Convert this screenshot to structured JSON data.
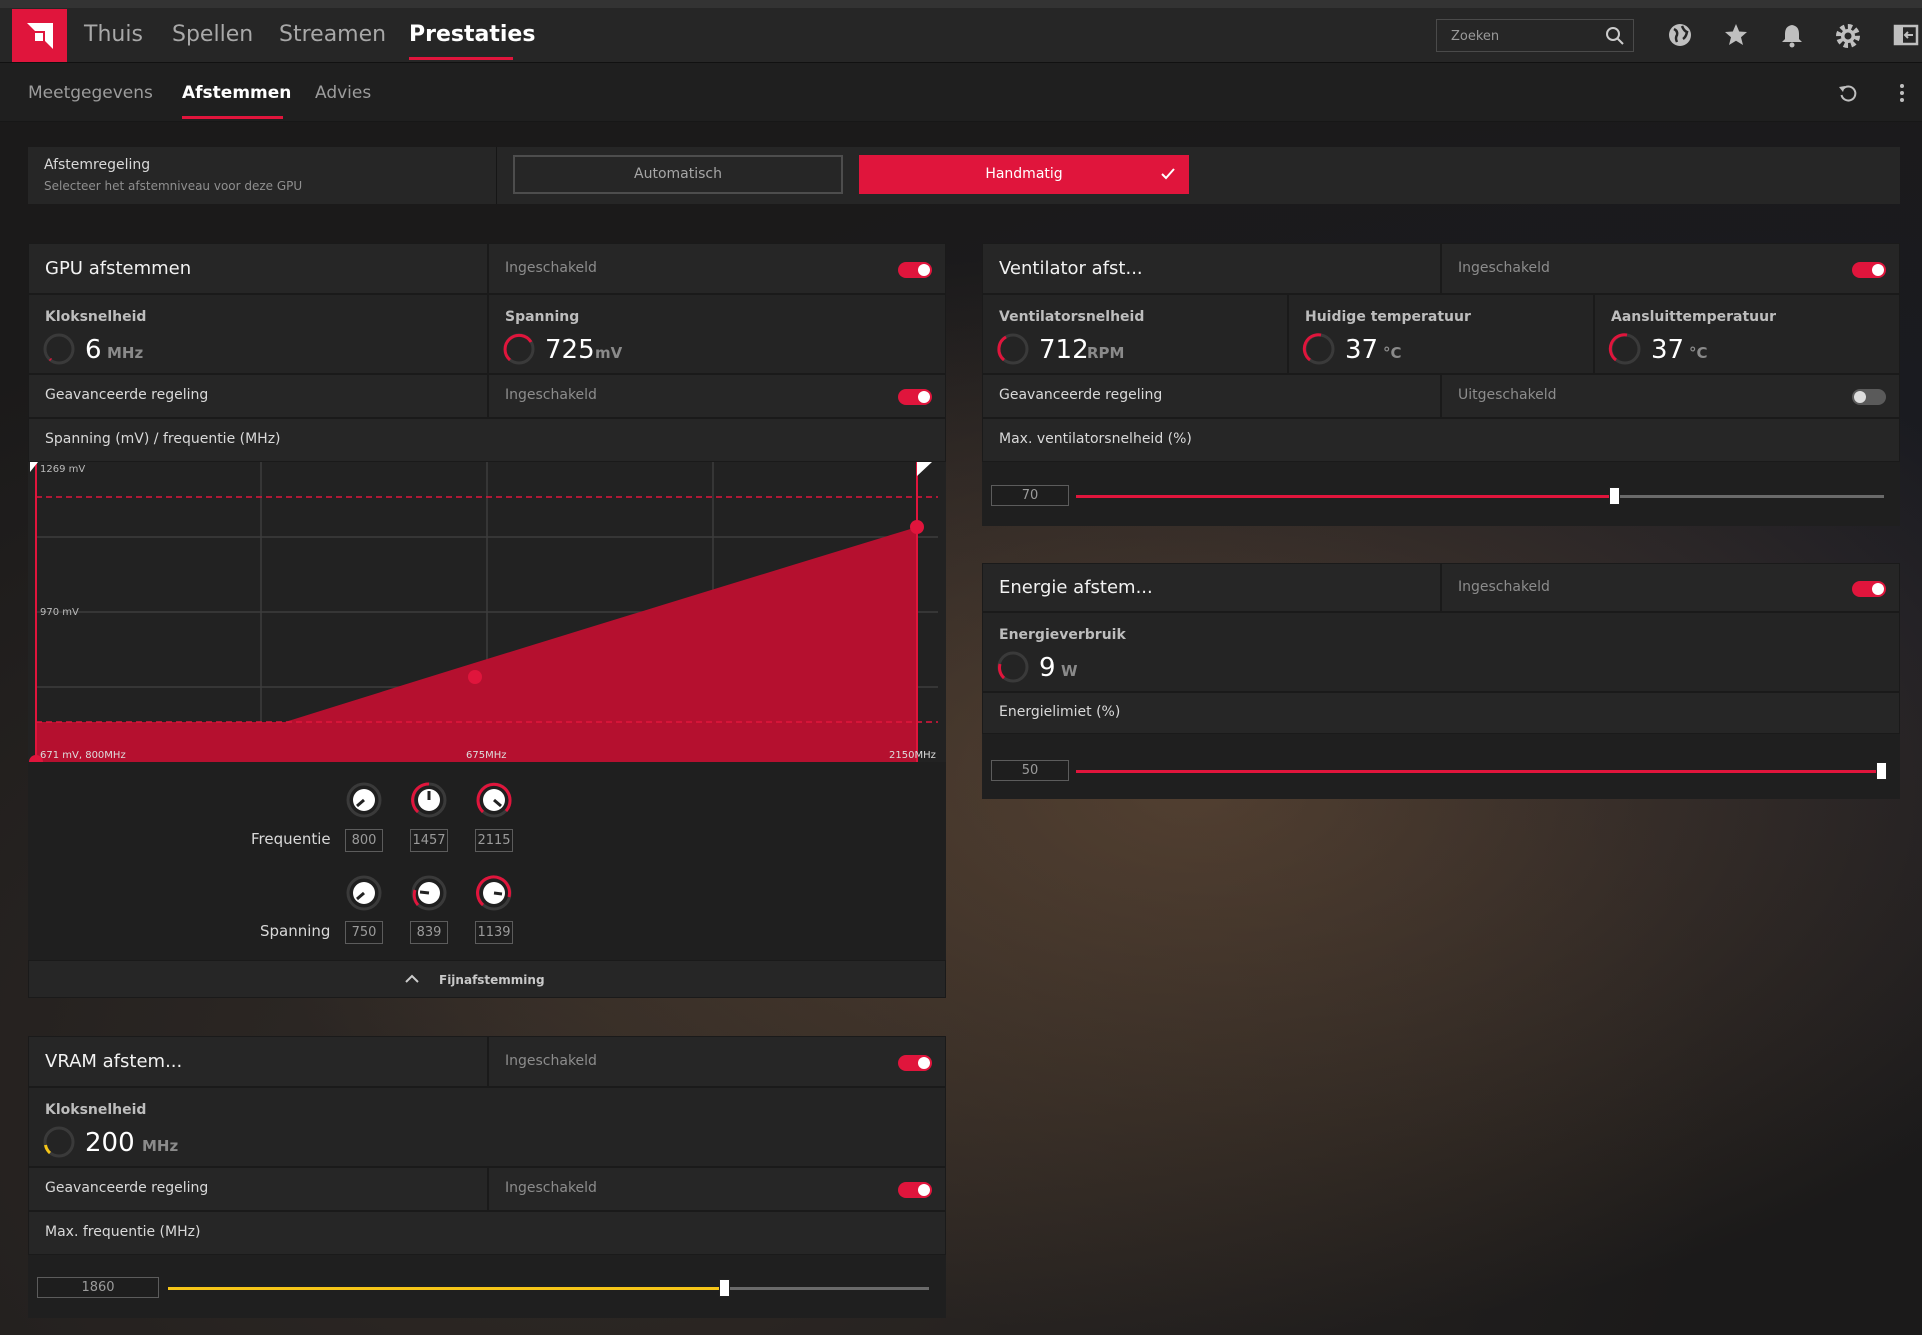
{
  "topnav": {
    "items": [
      "Thuis",
      "Spellen",
      "Streamen",
      "Prestaties"
    ],
    "active": "Prestaties",
    "search_placeholder": "Zoeken"
  },
  "subnav": {
    "items": [
      "Meetgegevens",
      "Afstemmen",
      "Advies"
    ],
    "active": "Afstemmen"
  },
  "tuning_control": {
    "title": "Afstemregeling",
    "subtitle": "Selecteer het afstemniveau voor deze GPU",
    "automatic": "Automatisch",
    "manual": "Handmatig"
  },
  "gpu": {
    "title": "GPU afstemmen",
    "status": "Ingeschakeld",
    "clock": {
      "label": "Kloksnelheid",
      "value": "6",
      "unit": "MHz"
    },
    "voltage": {
      "label": "Spanning",
      "value": "725",
      "unit": "mV"
    },
    "advanced": {
      "label": "Geavanceerde regeling",
      "status": "Ingeschakeld"
    },
    "curve_title": "Spanning (mV) / frequentie (MHz)",
    "chart": {
      "top_label": "1269 mV",
      "mid_label": "970 mV",
      "bottom_left": "671 mV, 800MHz",
      "bottom_mid": "675MHz",
      "bottom_right": "2150MHz"
    },
    "frequency_label": "Frequentie",
    "frequency_values": [
      "800",
      "1457",
      "2115"
    ],
    "voltage_label": "Spanning",
    "voltage_values": [
      "750",
      "839",
      "1139"
    ],
    "fine_tune": "Fijnafstemming"
  },
  "vram": {
    "title": "VRAM afstem...",
    "status": "Ingeschakeld",
    "clock": {
      "label": "Kloksnelheid",
      "value": "200",
      "unit": "MHz"
    },
    "advanced": {
      "label": "Geavanceerde regeling",
      "status": "Ingeschakeld"
    },
    "max_freq_label": "Max. frequentie (MHz)",
    "max_freq_value": "1860"
  },
  "fan": {
    "title": "Ventilator afst...",
    "status": "Ingeschakeld",
    "speed": {
      "label": "Ventilatorsnelheid",
      "value": "712",
      "unit": "RPM"
    },
    "current_temp": {
      "label": "Huidige temperatuur",
      "value": "37",
      "unit": "°C"
    },
    "junction_temp": {
      "label": "Aansluittemperatuur",
      "value": "37",
      "unit": "°C"
    },
    "advanced": {
      "label": "Geavanceerde regeling",
      "status": "Uitgeschakeld"
    },
    "max_speed_label": "Max. ventilatorsnelheid (%)",
    "max_speed_value": "70"
  },
  "power": {
    "title": "Energie afstem...",
    "status": "Ingeschakeld",
    "consumption": {
      "label": "Energieverbruik",
      "value": "9",
      "unit": "W"
    },
    "limit_label": "Energielimiet (%)",
    "limit_value": "50"
  },
  "colors": {
    "accent": "#e0153c",
    "vram_accent": "#f5c518",
    "panel": "#262626"
  }
}
